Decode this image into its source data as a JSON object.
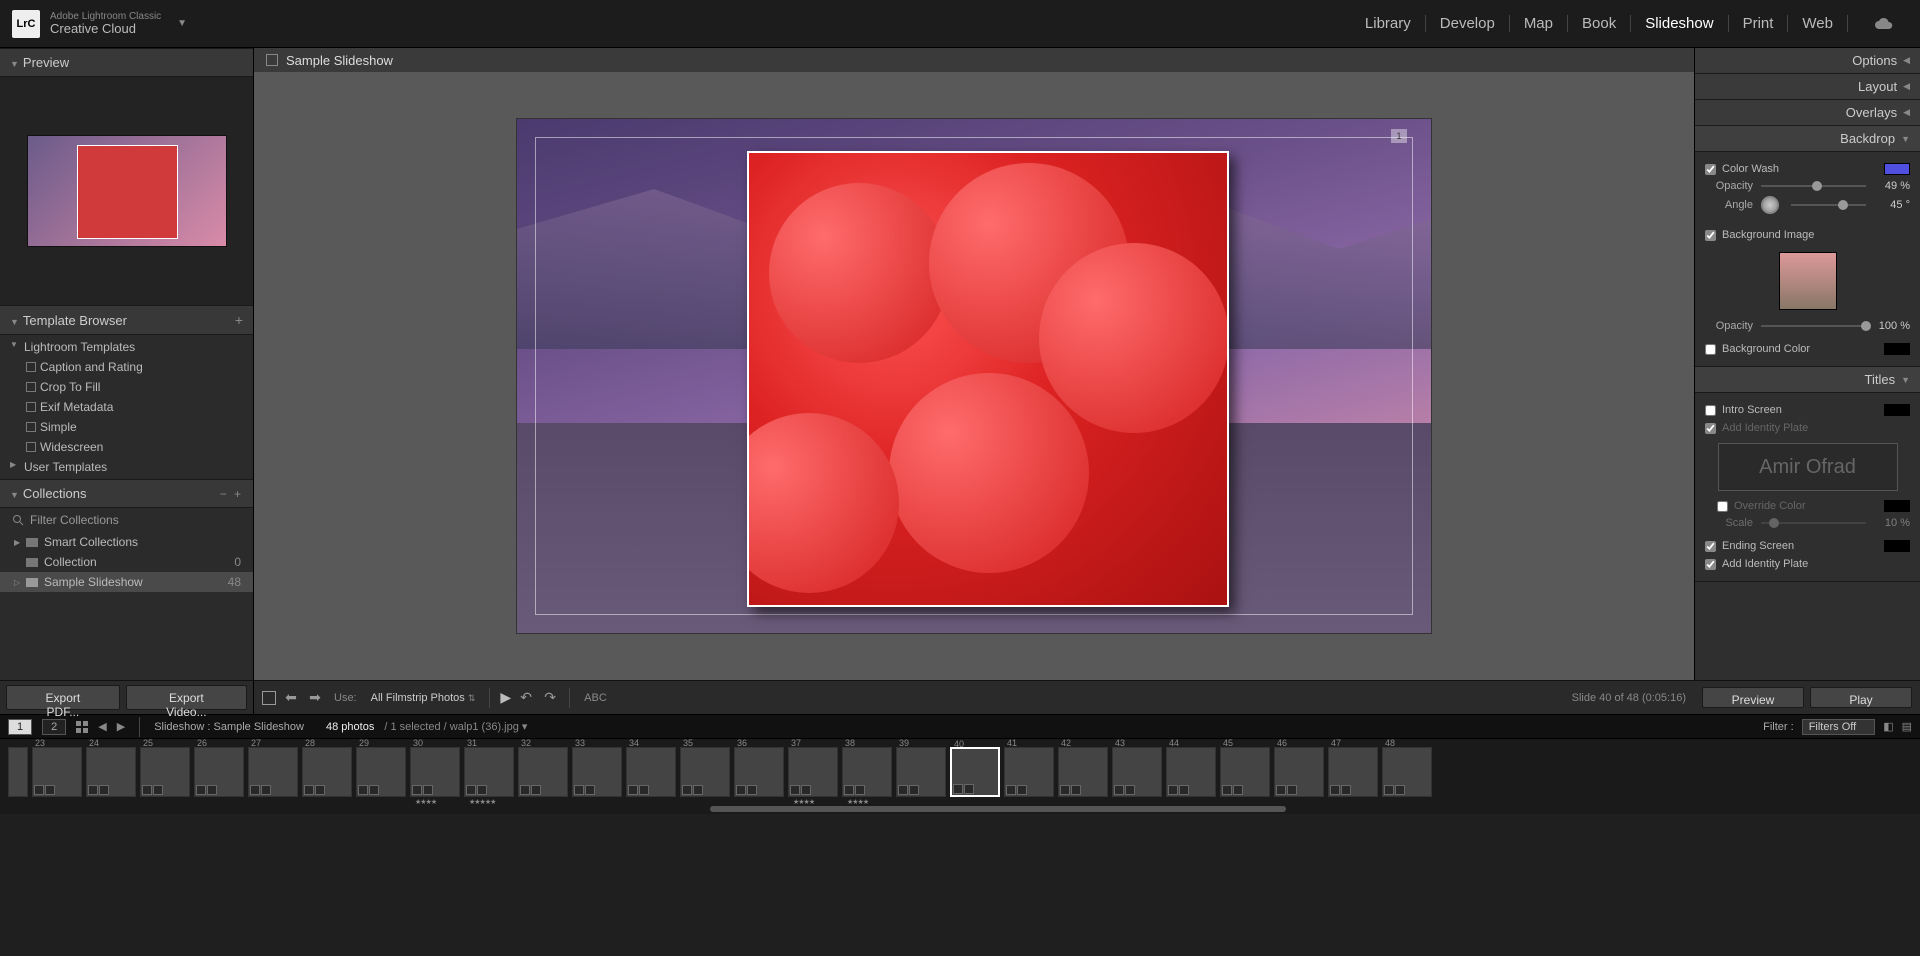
{
  "brand": {
    "logo": "LrC",
    "sub": "Adobe Lightroom Classic",
    "main": "Creative Cloud"
  },
  "modules": {
    "library": "Library",
    "develop": "Develop",
    "map": "Map",
    "book": "Book",
    "slideshow": "Slideshow",
    "print": "Print",
    "web": "Web"
  },
  "left": {
    "preview": "Preview",
    "templateBrowser": "Template Browser",
    "lightroomTemplates": "Lightroom Templates",
    "tpl": {
      "caption": "Caption and Rating",
      "crop": "Crop To Fill",
      "exif": "Exif Metadata",
      "simple": "Simple",
      "wide": "Widescreen"
    },
    "userTemplates": "User Templates",
    "collections": "Collections",
    "filterCollections": "Filter Collections",
    "smart": "Smart Collections",
    "collection": "Collection",
    "collectionCount": "0",
    "sample": "Sample Slideshow",
    "sampleCount": "48"
  },
  "center": {
    "title": "Sample Slideshow",
    "slideNum": "1"
  },
  "toolbar": {
    "exportPdf": "Export PDF...",
    "exportVideo": "Export Video...",
    "useLabel": "Use:",
    "useValue": "All Filmstrip Photos",
    "abc": "ABC",
    "counter": "Slide 40 of 48 (0:05:16)",
    "preview": "Preview",
    "play": "Play"
  },
  "right": {
    "options": "Options",
    "layout": "Layout",
    "overlays": "Overlays",
    "backdrop": "Backdrop",
    "colorWash": "Color Wash",
    "opacity": "Opacity",
    "opacityVal": "49 %",
    "angle": "Angle",
    "angleVal": "45 °",
    "bgImage": "Background Image",
    "bgOpacity": "Opacity",
    "bgOpacityVal": "100 %",
    "bgColor": "Background Color",
    "titles": "Titles",
    "introScreen": "Intro Screen",
    "addIdentity": "Add Identity Plate",
    "identityText": "Amir Ofrad",
    "overrideColor": "Override Color",
    "scale": "Scale",
    "scaleVal": "10 %",
    "endingScreen": "Ending Screen",
    "addIdentity2": "Add Identity Plate"
  },
  "status": {
    "breadcrumb": "Slideshow : Sample Slideshow",
    "photoCount": "48 photos",
    "selected": "/ 1 selected  / walp1 (36).jpg ▾",
    "filterLabel": "Filter :",
    "filtersOff": "Filters Off"
  },
  "filmstrip": {
    "start": 2
  }
}
